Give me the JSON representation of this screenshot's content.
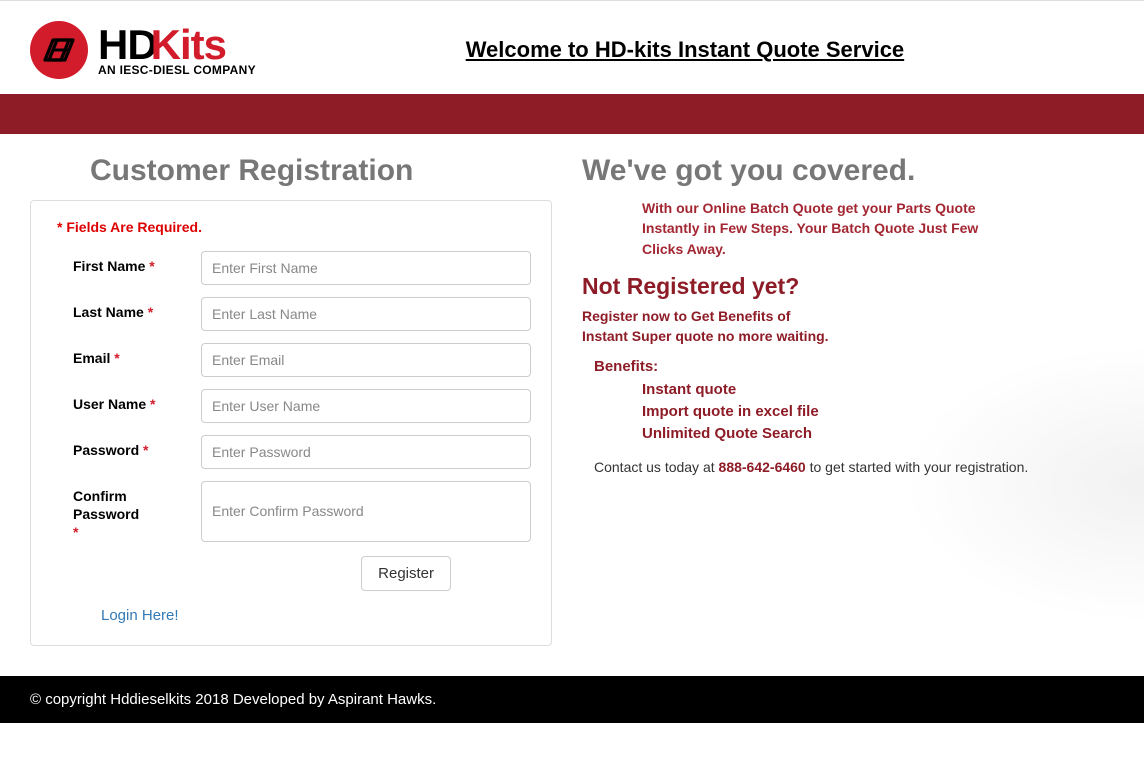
{
  "header": {
    "logo_black": "HD",
    "logo_red": "Kits",
    "logo_sub": "AN IESC-DIESL COMPANY",
    "welcome": "Welcome to HD-kits Instant Quote Service"
  },
  "registration": {
    "heading": "Customer Registration",
    "required_note": "* Fields Are Required.",
    "fields": {
      "first_name": {
        "label": "First Name",
        "placeholder": "Enter First Name"
      },
      "last_name": {
        "label": "Last Name",
        "placeholder": "Enter Last Name"
      },
      "email": {
        "label": "Email",
        "placeholder": "Enter Email"
      },
      "user_name": {
        "label": "User Name",
        "placeholder": "Enter User Name"
      },
      "password": {
        "label": "Password",
        "placeholder": "Enter Password"
      },
      "confirm_password": {
        "label": "Confirm Password",
        "placeholder": "Enter Confirm Password"
      }
    },
    "register_button": "Register",
    "login_link": "Login Here!"
  },
  "info": {
    "title": "We've got you covered.",
    "promo": "With our Online Batch Quote get your Parts Quote Instantly in Few Steps. Your Batch Quote Just Few Clicks Away.",
    "not_registered": "Not Registered yet?",
    "register_now_1": "Register now to Get Benefits of",
    "register_now_2": "Instant Super quote no more waiting.",
    "benefits_label": "Benefits:",
    "benefits": [
      "Instant quote",
      "Import quote in excel file",
      "Unlimited Quote Search"
    ],
    "contact_pre": "Contact us today at ",
    "contact_phone": "888-642-6460",
    "contact_post": " to get started with your registration."
  },
  "footer": "© copyright Hddieselkits 2018 Developed by Aspirant Hawks."
}
